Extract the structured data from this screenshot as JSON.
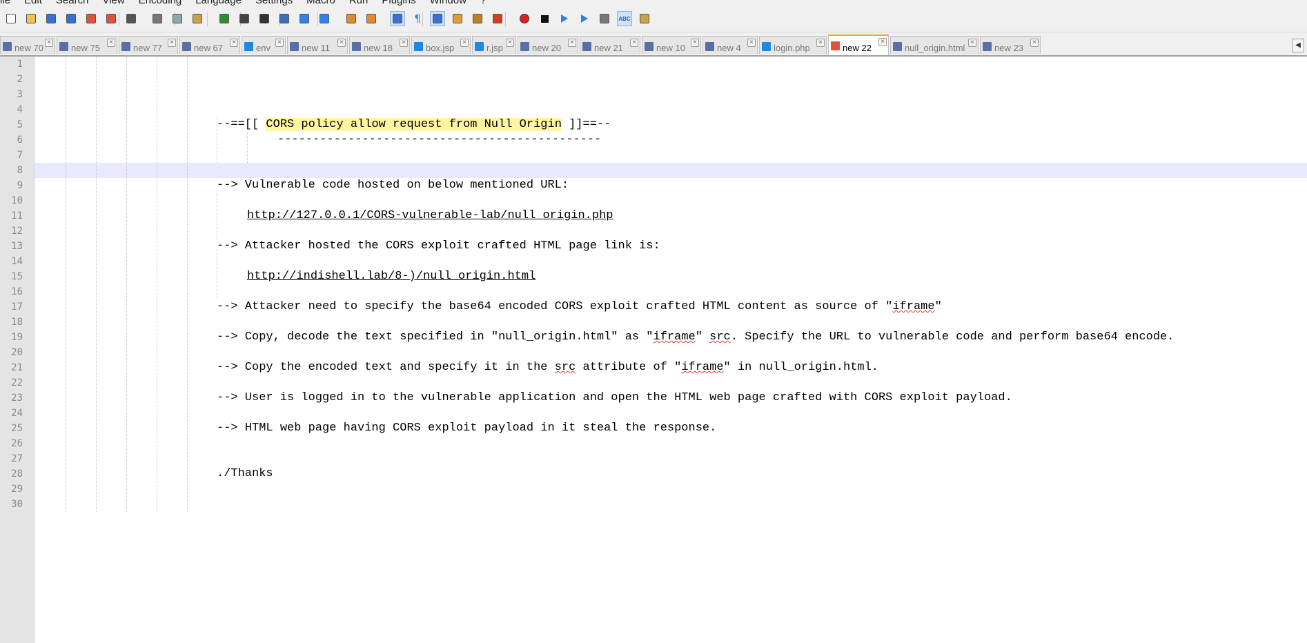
{
  "menu": [
    "ile",
    "Edit",
    "Search",
    "View",
    "Encoding",
    "Language",
    "Settings",
    "Macro",
    "Run",
    "Plugins",
    "Window",
    "?"
  ],
  "toolbar_icons": [
    "new-file-icon",
    "open-file-icon",
    "save-icon",
    "save-all-icon",
    "close-icon",
    "close-all-icon",
    "print-icon",
    "cut-icon",
    "copy-icon",
    "paste-icon",
    "undo-icon",
    "redo-icon",
    "find-icon",
    "replace-icon",
    "zoom-in-icon",
    "zoom-out-icon",
    "sync-vertical-icon",
    "sync-horizontal-icon",
    "word-wrap-icon",
    "show-all-chars-icon",
    "indent-guide-icon",
    "doc-map-icon",
    "function-list-icon",
    "folder-workspace-icon",
    "record-macro-icon",
    "stop-record-icon",
    "play-macro-icon",
    "run-macro-multiple-icon",
    "save-macro-icon",
    "spellcheck-icon",
    "spellcheck-settings-icon"
  ],
  "tabs": [
    {
      "label": "new 70",
      "icon": "saved"
    },
    {
      "label": "new 75",
      "icon": "saved"
    },
    {
      "label": "new 77",
      "icon": "saved"
    },
    {
      "label": "new 67",
      "icon": "saved"
    },
    {
      "label": "env",
      "icon": "blue"
    },
    {
      "label": "new 11",
      "icon": "saved"
    },
    {
      "label": "new 18",
      "icon": "saved"
    },
    {
      "label": "box.jsp",
      "icon": "blue"
    },
    {
      "label": "r.jsp",
      "icon": "blue"
    },
    {
      "label": "new 20",
      "icon": "saved"
    },
    {
      "label": "new 21",
      "icon": "saved"
    },
    {
      "label": "new 10",
      "icon": "saved"
    },
    {
      "label": "new 4",
      "icon": "saved"
    },
    {
      "label": "login.php",
      "icon": "blue"
    },
    {
      "label": "new 22",
      "icon": "red",
      "active": true
    },
    {
      "label": "null_origin.html",
      "icon": "saved"
    },
    {
      "label": "new 23",
      "icon": "saved"
    }
  ],
  "tab_scroll_left": "◀",
  "line_count": 30,
  "current_line": 8,
  "lines": {
    "l5_pre": "--==[[ ",
    "l5_hl": "CORS policy allow request from Null Origin",
    "l5_post": " ]]==--",
    "l6": "----------------------------------------------",
    "l9": "--> Vulnerable code hosted on below mentioned URL:",
    "l11": "http://127.0.0.1/CORS-vulnerable-lab/null_origin.php",
    "l13": "--> Attacker hosted the CORS exploit crafted HTML page link is:",
    "l15": "http://indishell.lab/8-)/null_origin.html",
    "l17_a": "--> Attacker need to specify the base64 encoded CORS exploit crafted HTML content as source of \"",
    "l17_b": "iframe",
    "l17_c": "\"",
    "l19_a": "--> Copy, decode the text specified in \"null_origin.html\" as \"",
    "l19_b": "iframe",
    "l19_c": "\" ",
    "l19_d": "src",
    "l19_e": ". Specify the URL to vulnerable code and perform base64 encode.",
    "l21_a": "--> Copy the encoded text and specify it in the ",
    "l21_b": "src",
    "l21_c": " attribute of \"",
    "l21_d": "iframe",
    "l21_e": "\" in null_origin.html.",
    "l23": "--> User is logged in to the vulnerable application and open the HTML web page crafted with CORS exploit payload.",
    "l25": "--> HTML web page having CORS exploit payload in it steal the response.",
    "l28": "./Thanks"
  }
}
